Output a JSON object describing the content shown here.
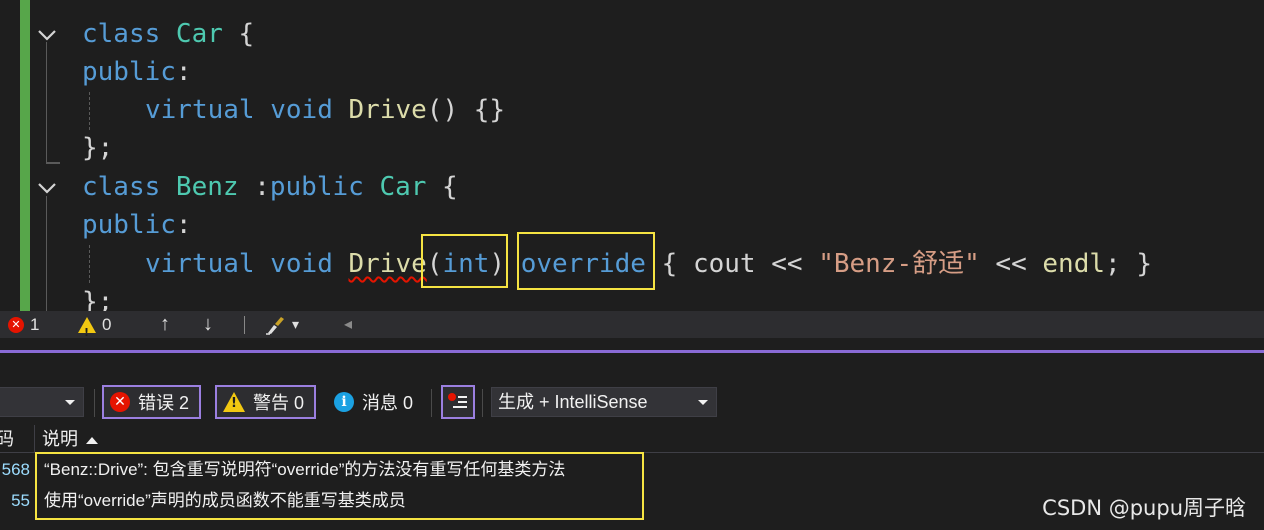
{
  "editor": {
    "lines": [
      {
        "tokens": [
          {
            "t": "class ",
            "c": "kw"
          },
          {
            "t": "Car",
            "c": "cls"
          },
          {
            "t": " {",
            "c": "br"
          }
        ]
      },
      {
        "tokens": [
          {
            "t": "public",
            "c": "kw"
          },
          {
            "t": ":",
            "c": "pn"
          }
        ]
      },
      {
        "tokens": [
          {
            "t": "virtual ",
            "c": "kw"
          },
          {
            "t": "void ",
            "c": "kw"
          },
          {
            "t": "Drive",
            "c": "fn"
          },
          {
            "t": "() {}",
            "c": "pn"
          }
        ]
      },
      {
        "tokens": [
          {
            "t": "};",
            "c": "pn"
          }
        ]
      },
      {
        "tokens": [
          {
            "t": "class ",
            "c": "kw"
          },
          {
            "t": "Benz",
            "c": "cls"
          },
          {
            "t": " :",
            "c": "pn"
          },
          {
            "t": "public ",
            "c": "kw"
          },
          {
            "t": "Car",
            "c": "cls"
          },
          {
            "t": " {",
            "c": "br"
          }
        ]
      },
      {
        "tokens": [
          {
            "t": "public",
            "c": "kw"
          },
          {
            "t": ":",
            "c": "pn"
          }
        ]
      },
      {
        "tokens": [
          {
            "t": "virtual ",
            "c": "kw"
          },
          {
            "t": "void ",
            "c": "kw"
          },
          {
            "t": "Drive",
            "c": "fn squiggle"
          },
          {
            "t": "(",
            "c": "pn"
          },
          {
            "t": "int",
            "c": "kw"
          },
          {
            "t": ") ",
            "c": "pn"
          },
          {
            "t": "override",
            "c": "kw"
          },
          {
            "t": " { ",
            "c": "pn"
          },
          {
            "t": "cout",
            "c": "id"
          },
          {
            "t": " << ",
            "c": "pn"
          },
          {
            "t": "\"Benz-舒适\"",
            "c": "str"
          },
          {
            "t": " << ",
            "c": "pn"
          },
          {
            "t": "endl",
            "c": "fn"
          },
          {
            "t": "; }",
            "c": "pn"
          }
        ]
      },
      {
        "tokens": [
          {
            "t": "};",
            "c": "pn"
          }
        ]
      }
    ]
  },
  "editor_status": {
    "errors": "1",
    "warnings": "0",
    "up_arrow": "↑",
    "down_arrow": "↓",
    "brush_caret": "▾",
    "scroll_left": "◂"
  },
  "error_list": {
    "filters": {
      "errors_label": "错误 2",
      "warnings_label": "警告 0",
      "messages_label": "消息 0"
    },
    "build_source": "生成 + IntelliSense",
    "columns": {
      "code": "码",
      "description": "说明"
    },
    "rows": [
      {
        "code": "568",
        "description": "“Benz::Drive”: 包含重写说明符“override”的方法没有重写任何基类方法"
      },
      {
        "code": "55",
        "description": "使用“override”声明的成员函数不能重写基类成员"
      }
    ]
  },
  "watermark": "CSDN @pupu周子晗",
  "colors": {
    "keyword": "#569cd6",
    "type": "#4ec9b0",
    "function": "#dcdcaa",
    "string": "#d69d85",
    "highlight": "#f5e342",
    "accent": "#8a6bd6",
    "error": "#e51400",
    "warning": "#f2c811"
  }
}
